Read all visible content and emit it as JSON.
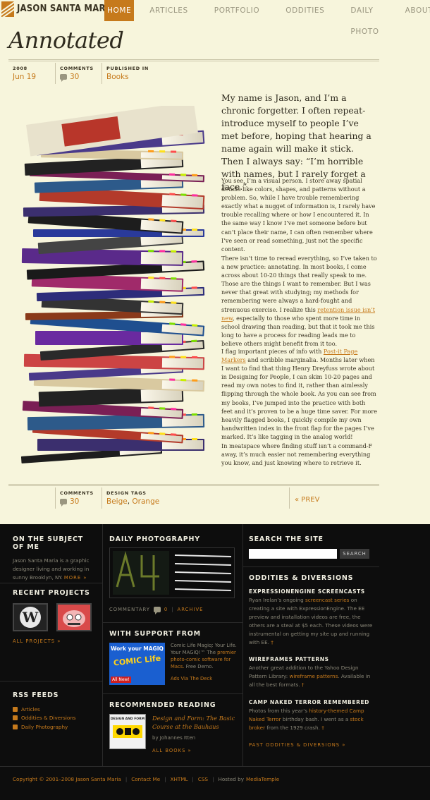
{
  "site": {
    "title": "JASON SANTA MARIA"
  },
  "nav": {
    "items": [
      "HOME",
      "ARTICLES",
      "PORTFOLIO",
      "ODDITIES",
      "DAILY PHOTO",
      "ABOUT"
    ]
  },
  "article": {
    "title": "Annotated",
    "year": "2008",
    "date": "Jun 19",
    "comments_label": "COMMENTS",
    "comments_count": "30",
    "published_label": "PUBLISHED IN",
    "published_value": "Books",
    "lead": "My name is Jason, and I’m a chronic forgetter. I often repeat-introduce myself to people I’ve met before, hoping that hearing a name again will make it stick. Then I always say: “I’m horrible with names, but I rarely forget a face.”",
    "p1": "You see, I’m a visual person. I store away spatial details like colors, shapes, and patterns without a problem. So, while I have trouble remembering exactly what a nugget of information is, I rarely have trouble recalling where or how I encountered it. In the same way I know I’ve met someone before but can’t place their name, I can often remember where I’ve seen or read something, just not the specific content.",
    "p2a": "There isn’t time to reread everything, so I’ve taken to a new practice: annotating. In most books, I come across about 10-20 things that really speak to me. Those are the things I want to remember. But I was never that great with studying; my methods for remembering were always a hard-fought and strenuous exercise. I realize this ",
    "p2link": "retention issue isn’t new",
    "p2b": ", especially to those who spent more time in school drawing than reading, but that it took me this long to have a process for reading leads me to believe others might benefit from it too.",
    "p3a": "I flag important pieces of info with ",
    "p3link": "Post-it Page Markers",
    "p3b": " and scribble marginalia. Months later when I want to find that thing Henry Dreyfuss wrote about in Designing for People, I can skim 10-20 pages and read my own notes to find it, rather than aimlessly flipping through the whole book. As you can see from my books, I’ve jumped into the practice with both feet and it’s proven to be a huge time saver. For more heavily flagged books, I quickly compile my own handwritten index in the front flap for the pages I’ve marked. It’s like tagging in the analog world!",
    "p4": "In meatspace where finding stuff isn’t a command-F away, it’s much easier not remembering everything you know, and just knowing where to retrieve it.",
    "tags_label": "DESIGN TAGS",
    "tag1": "Beige",
    "tag_sep": ", ",
    "tag2": "Orange",
    "prev": "« PREV"
  },
  "footer": {
    "subject": {
      "heading": "ON THE SUBJECT OF ME",
      "text": "Jason Santa Maria is a graphic designer living and working in sunny Brooklyn, NY.",
      "more": "MORE »"
    },
    "projects": {
      "heading": "RECENT PROJECTS",
      "all": "ALL PROJECTS »"
    },
    "rss": {
      "heading": "RSS FEEDS",
      "items": [
        "Articles",
        "Oddities & Diversions",
        "Daily Photography"
      ]
    },
    "photo": {
      "heading": "DAILY PHOTOGRAPHY",
      "commentary": "COMMENTARY",
      "count": "0",
      "archive": "ARCHIVE"
    },
    "support": {
      "heading": "WITH SUPPORT FROM",
      "ad_line1": "Work your MAGIQ",
      "ad_line2": "COMIC Life",
      "ad_line3": "All New!",
      "text1": "Comic Life Magiq: Your Life. Your MAGIQ!™ The ",
      "link": "premier photo-comic software for Macs.",
      "text2": " Free Demo.",
      "via": "Ads Via The Deck"
    },
    "reading": {
      "heading": "RECOMMENDED READING",
      "book_cover": "DESIGN AND FORM",
      "title": "Design and Form: The Basic Course at the Bauhaus",
      "author": "by Johannes Itten",
      "all": "ALL BOOKS »"
    },
    "search": {
      "heading": "SEARCH THE SITE",
      "button": "SEARCH",
      "placeholder": ""
    },
    "oddities": {
      "heading": "ODDITIES & DIVERSIONS",
      "items": [
        {
          "title": "EXPRESSIONENGINE SCREENCASTS"
        },
        {
          "title": "WIREFRAMES PATTERNS"
        },
        {
          "title": "CAMP NAKED TERROR REMEMBERED"
        }
      ],
      "e1a": "Ryan Irelan’s ongoing ",
      "e1link": "screencast series",
      "e1b": " on creating a site with ExpressionEngine. The EE preview and installation videos are free, the others are a steal at $5 each. These videos were instrumental on getting my site up and running with EE.",
      "e2a": "Another great addition to the Yahoo Design Pattern Library: ",
      "e2link": "wireframe patterns",
      "e2b": ". Available in all the best formats.",
      "e3a": "Photos from this year’s ",
      "e3link": "history-themed Camp Naked Terror",
      "e3b": " birthday bash. I went as a ",
      "e3link2": "stock broker",
      "e3c": " from the 1929 crash.",
      "dagger": "†",
      "past": "PAST ODDITIES & DIVERSIONS »"
    },
    "copyright": {
      "text": "Copyright © 2001–2008 Jason Santa Maria",
      "contact": "Contact Me",
      "xhtml": "XHTML",
      "css": "CSS",
      "hosted": "Hosted by",
      "host": "MediaTemple",
      "sep": "|"
    }
  },
  "colors": {
    "accent": "#c67a1c",
    "background": "#f7f5dc",
    "footer_bg": "#0d0d0d"
  }
}
